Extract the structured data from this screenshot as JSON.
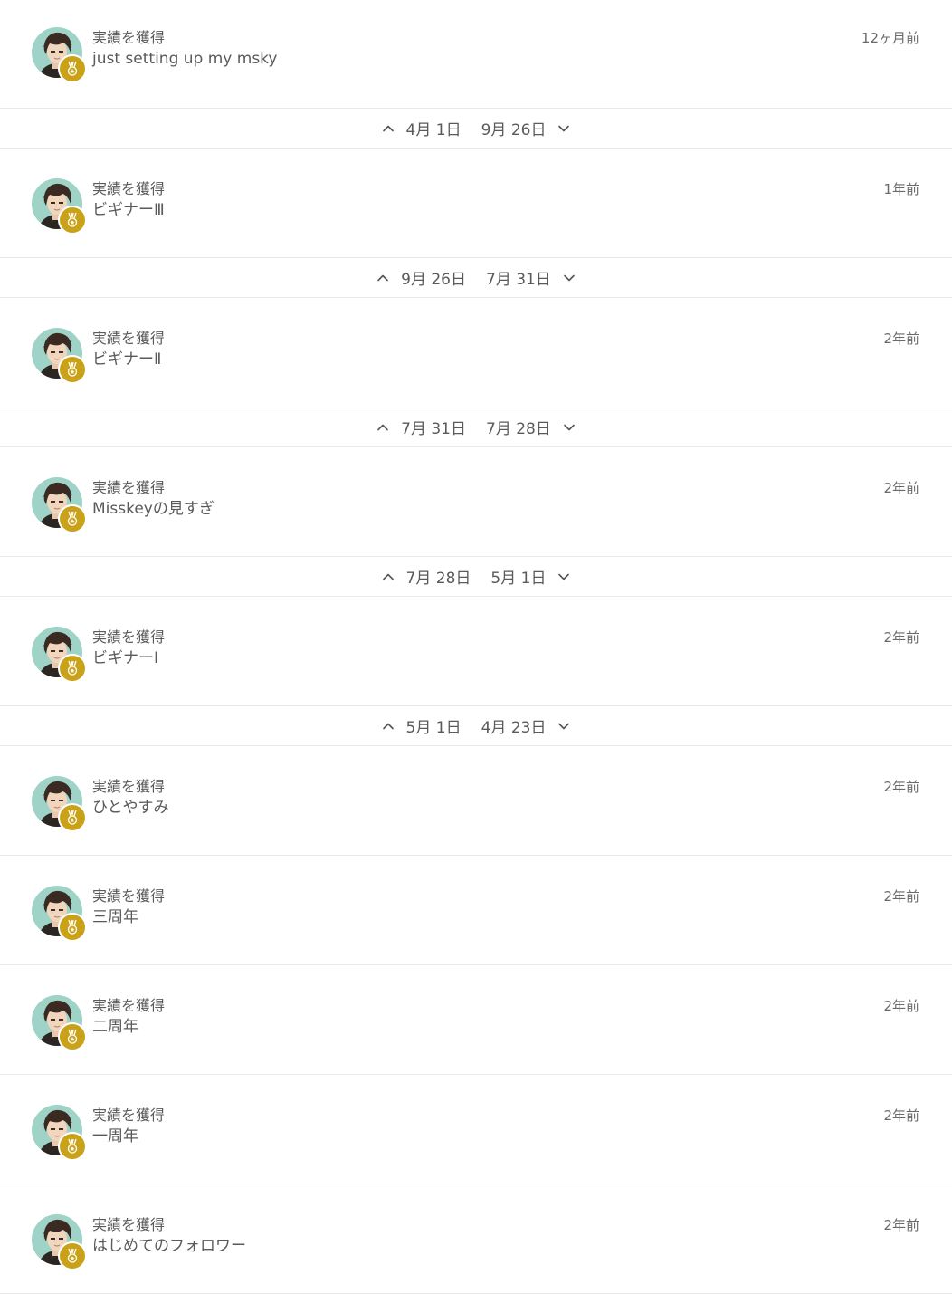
{
  "notifications": [
    {
      "type": "実績を獲得",
      "name": "just setting up my msky",
      "time": "12ヶ月前"
    },
    {
      "type": "実績を獲得",
      "name": "ビギナーⅢ",
      "time": "1年前"
    },
    {
      "type": "実績を獲得",
      "name": "ビギナーⅡ",
      "time": "2年前"
    },
    {
      "type": "実績を獲得",
      "name": "Misskeyの見すぎ",
      "time": "2年前"
    },
    {
      "type": "実績を獲得",
      "name": "ビギナーⅠ",
      "time": "2年前"
    },
    {
      "type": "実績を獲得",
      "name": "ひとやすみ",
      "time": "2年前"
    },
    {
      "type": "実績を獲得",
      "name": "三周年",
      "time": "2年前"
    },
    {
      "type": "実績を獲得",
      "name": "二周年",
      "time": "2年前"
    },
    {
      "type": "実績を獲得",
      "name": "一周年",
      "time": "2年前"
    },
    {
      "type": "実績を獲得",
      "name": "はじめてのフォロワー",
      "time": "2年前"
    }
  ],
  "date_separators": [
    {
      "after": 0,
      "prev": "4月 1日",
      "next": "9月 26日"
    },
    {
      "after": 1,
      "prev": "9月 26日",
      "next": "7月 31日"
    },
    {
      "after": 2,
      "prev": "7月 31日",
      "next": "7月 28日"
    },
    {
      "after": 3,
      "prev": "7月 28日",
      "next": "5月 1日"
    },
    {
      "after": 4,
      "prev": "5月 1日",
      "next": "4月 23日"
    }
  ],
  "icons": {
    "avatar": "user-avatar",
    "badge": "medal-icon",
    "up": "chevron-up-icon",
    "down": "chevron-down-icon"
  },
  "colors": {
    "badge": "#c9a21a",
    "avatar_bg": "#9fd3c7",
    "divider": "#e9e9e9",
    "text": "#5a5a5a"
  }
}
